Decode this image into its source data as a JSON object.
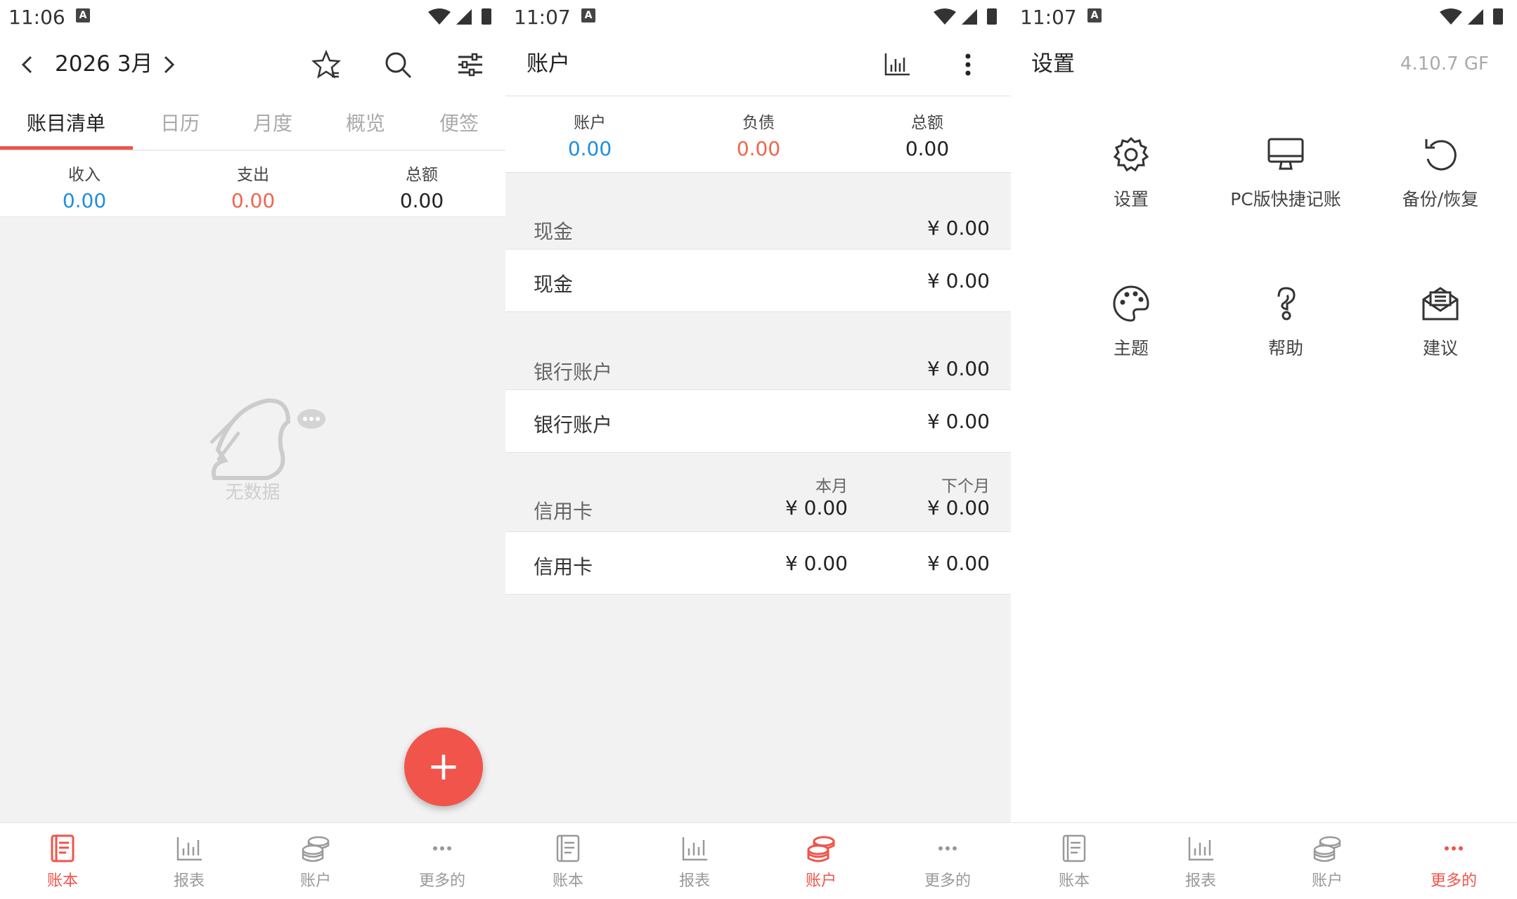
{
  "screen1": {
    "status_time": "11:06",
    "status_a": "A",
    "month": "2026 3月",
    "tabs": [
      "账目清单",
      "日历",
      "月度",
      "概览",
      "便签"
    ],
    "summary": {
      "income_label": "收入",
      "income_value": "0.00",
      "expense_label": "支出",
      "expense_value": "0.00",
      "total_label": "总额",
      "total_value": "0.00"
    },
    "empty_text": "无数据",
    "fab_label": "+"
  },
  "screen2": {
    "status_time": "11:07",
    "status_a": "A",
    "title": "账户",
    "summary": {
      "account_label": "账户",
      "account_value": "0.00",
      "debt_label": "负债",
      "debt_value": "0.00",
      "total_label": "总额",
      "total_value": "0.00"
    },
    "groups": [
      {
        "name": "现金",
        "amount": "¥ 0.00",
        "row_name": "现金",
        "row_amount": "¥ 0.00"
      },
      {
        "name": "银行账户",
        "amount": "¥ 0.00",
        "row_name": "银行账户",
        "row_amount": "¥ 0.00"
      }
    ],
    "credit": {
      "name": "信用卡",
      "this_month_label": "本月",
      "this_month_value": "¥ 0.00",
      "next_month_label": "下个月",
      "next_month_value": "¥ 0.00",
      "row_name": "信用卡",
      "row_this": "¥ 0.00",
      "row_next": "¥ 0.00"
    }
  },
  "screen3": {
    "status_time": "11:07",
    "status_a": "A",
    "title": "设置",
    "version": "4.10.7 GF",
    "items": [
      {
        "label": "设置",
        "icon": "gear-icon"
      },
      {
        "label": "PC版快捷记账",
        "icon": "monitor-icon"
      },
      {
        "label": "备份/恢复",
        "icon": "restore-icon"
      },
      {
        "label": "主题",
        "icon": "palette-icon"
      },
      {
        "label": "帮助",
        "icon": "help-icon"
      },
      {
        "label": "建议",
        "icon": "mail-icon"
      }
    ]
  },
  "bottom_nav": [
    "账本",
    "报表",
    "账户",
    "更多的"
  ],
  "colors": {
    "accent": "#f0544a",
    "blue": "#1e8fe1",
    "orange": "#f0654f",
    "nav_inactive": "#999999"
  }
}
